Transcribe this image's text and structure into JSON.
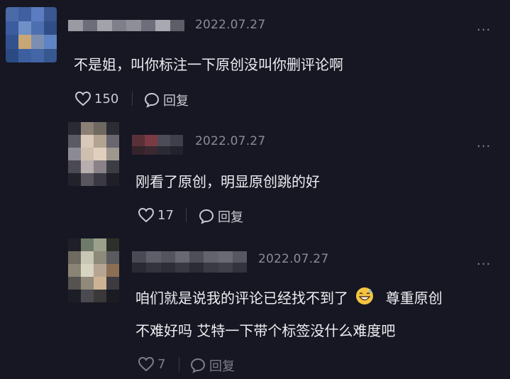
{
  "comments": [
    {
      "date": "2022.07.27",
      "text": "不是姐，叫你标注一下原创没叫你删评论啊",
      "likes": "150",
      "reply_label": "回复"
    },
    {
      "date": "2022.07.27",
      "text": "刚看了原创，明显原创跳的好",
      "likes": "17",
      "reply_label": "回复"
    },
    {
      "date": "2022.07.27",
      "text_line1_a": "咱们就是说我的评论已经找不到了",
      "text_line1_b": "尊重原创",
      "text_line2": "不难好吗 艾特一下带个标签没什么难度吧",
      "likes": "7",
      "reply_label": "回复"
    }
  ],
  "more_glyph": "···",
  "colors": {
    "background": "#161722",
    "accent_text": "#eceef2",
    "muted": "#8a8b95"
  },
  "icons": [
    "heart-icon",
    "comment-bubble-icon",
    "more-icon",
    "grin-sweat-emoji"
  ]
}
